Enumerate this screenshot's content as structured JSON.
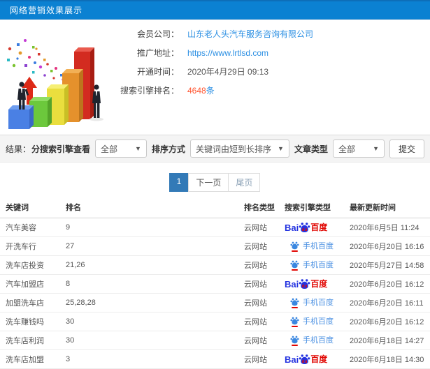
{
  "header": {
    "title": "网络营销效果展示"
  },
  "info": {
    "member_company": {
      "label": "会员公司：",
      "value": "山东老人头汽车服务咨询有限公司"
    },
    "promo_url": {
      "label": "推广地址：",
      "value": "https://www.lrtlsd.com"
    },
    "open_time": {
      "label": "开通时间：",
      "value": "2020年4月29日 09:13"
    },
    "engine_rank": {
      "label": "搜索引擎排名：",
      "value": "4648",
      "unit": "条"
    }
  },
  "filters": {
    "result_label": "结果：",
    "engine_label": "分搜索引擎查看",
    "engine_value": "全部",
    "sort_label": "排序方式",
    "sort_value": "关键词由短到长排序",
    "article_label": "文章类型",
    "article_value": "全部",
    "submit_label": "提交",
    "caret": "▼"
  },
  "pagination": {
    "current": "1",
    "next": "下一页",
    "last": "尾页"
  },
  "table": {
    "headers": [
      "关键词",
      "排名",
      "排名类型",
      "搜索引擎类型",
      "最新更新时间"
    ],
    "rows": [
      {
        "keyword": "汽车美容",
        "rank": "9",
        "rank_type": "云网站",
        "engine": "baidu",
        "updated": "2020年6月5日 11:24"
      },
      {
        "keyword": "开洗车行",
        "rank": "27",
        "rank_type": "云网站",
        "engine": "mobile_baidu",
        "updated": "2020年6月20日 16:16"
      },
      {
        "keyword": "洗车店投资",
        "rank": "21,26",
        "rank_type": "云网站",
        "engine": "mobile_baidu",
        "updated": "2020年5月27日 14:58"
      },
      {
        "keyword": "汽车加盟店",
        "rank": "8",
        "rank_type": "云网站",
        "engine": "baidu",
        "updated": "2020年6月20日 16:12"
      },
      {
        "keyword": "加盟洗车店",
        "rank": "25,28,28",
        "rank_type": "云网站",
        "engine": "mobile_baidu",
        "updated": "2020年6月20日 16:11"
      },
      {
        "keyword": "洗车赚钱吗",
        "rank": "30",
        "rank_type": "云网站",
        "engine": "mobile_baidu",
        "updated": "2020年6月20日 16:12"
      },
      {
        "keyword": "洗车店利润",
        "rank": "30",
        "rank_type": "云网站",
        "engine": "mobile_baidu",
        "updated": "2020年6月18日 14:27"
      },
      {
        "keyword": "洗车店加盟",
        "rank": "3",
        "rank_type": "云网站",
        "engine": "baidu",
        "updated": "2020年6月18日 14:30"
      }
    ]
  },
  "engines": {
    "baidu": {
      "latin": "Bai",
      "du": "du",
      "cn": "百度"
    },
    "mobile_baidu": {
      "label": "手机百度"
    }
  },
  "colors": {
    "topbar_blue": "#0b81d2",
    "link_blue": "#2b8fe3",
    "rank_blue": "#337ab7",
    "highlight_orange": "#ff5530",
    "baidu_blue": "#2433e0",
    "baidu_red": "#e10602",
    "filter_bg": "#f4f4f4"
  }
}
